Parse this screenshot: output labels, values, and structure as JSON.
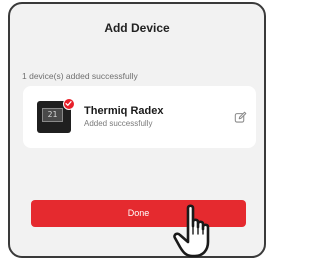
{
  "dialog": {
    "title": "Add Device",
    "status_text": "1 device(s) added successfully",
    "device": {
      "name": "Thermiq Radex",
      "subtitle": "Added successfully",
      "display_value": "21",
      "icon": "edit-icon",
      "badge_icon": "check-icon",
      "badge_color": "#e8202a"
    },
    "done_button": {
      "label": "Done",
      "color": "#e52a2f"
    }
  },
  "cursor": {
    "icon": "hand-pointer-icon"
  }
}
